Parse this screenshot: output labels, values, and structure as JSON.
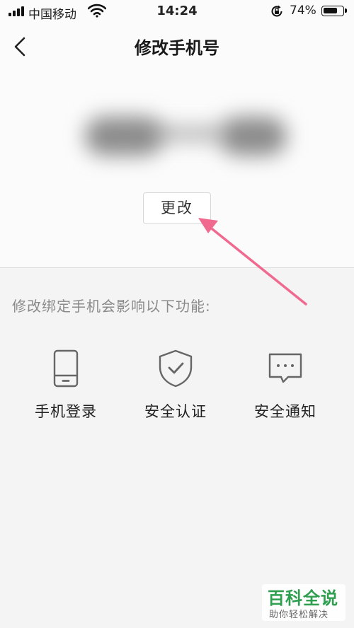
{
  "status_bar": {
    "carrier": "中国移动",
    "time": "14:24",
    "battery_percent": "74%",
    "battery_level": 0.74
  },
  "nav": {
    "title": "修改手机号"
  },
  "phone": {
    "change_label": "更改"
  },
  "info": {
    "note": "修改绑定手机会影响以下功能:",
    "features": [
      {
        "icon": "phone-icon",
        "label": "手机登录"
      },
      {
        "icon": "shield-check-icon",
        "label": "安全认证"
      },
      {
        "icon": "message-icon",
        "label": "安全通知"
      }
    ]
  },
  "watermark": {
    "title": "百科全说",
    "subtitle": "助你轻松解决"
  },
  "colors": {
    "annotation_arrow": "#f06a8f",
    "watermark_green": "#2e9e4f"
  }
}
